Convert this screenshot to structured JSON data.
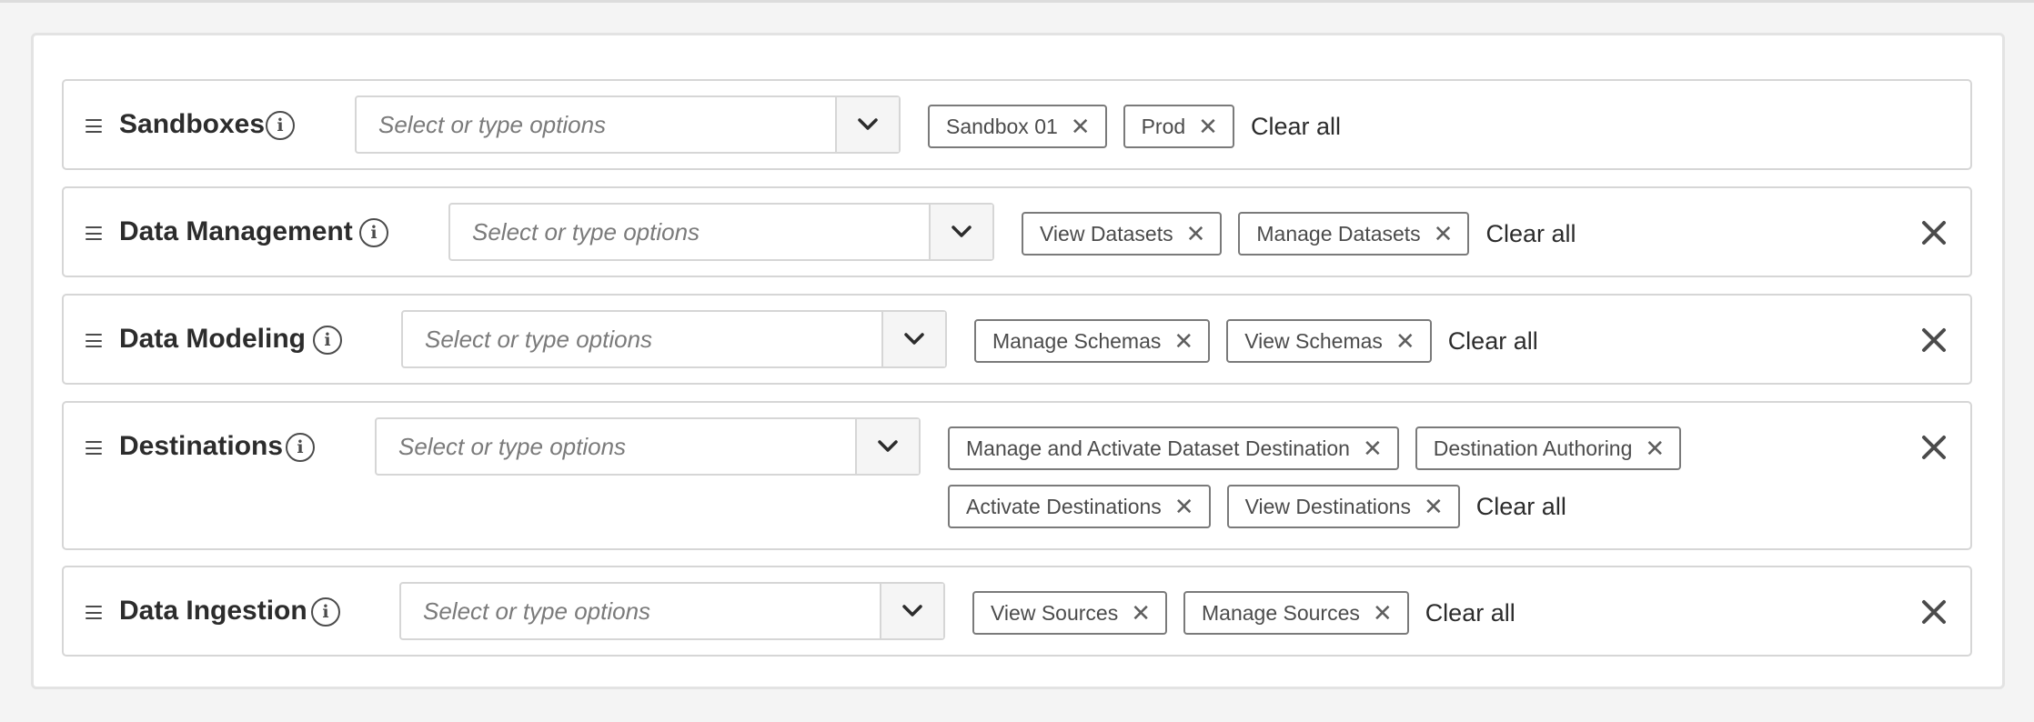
{
  "placeholder": "Select or type options",
  "clear_all_label": "Clear all",
  "icons": {
    "drag_handle": "drag-handle-icon",
    "info": "info-icon",
    "dropdown": "chevron-down-icon",
    "remove_tag": "close-icon",
    "remove_row": "close-icon",
    "info_glyph": "i",
    "tag_remove_glyph": "✕"
  },
  "colors": {
    "page_background": "#f4f4f4",
    "panel_background": "#ffffff",
    "border": "#d6d6d6",
    "tag_border": "#7a7a7a",
    "text": "#2c2c2c"
  },
  "rows": [
    {
      "title": "Sandboxes",
      "removable": false,
      "tags": [
        {
          "label": "Sandbox 01"
        },
        {
          "label": "Prod"
        }
      ]
    },
    {
      "title": "Data Management",
      "removable": true,
      "tags": [
        {
          "label": "View Datasets"
        },
        {
          "label": "Manage Datasets"
        }
      ]
    },
    {
      "title": "Data Modeling",
      "removable": true,
      "tags": [
        {
          "label": "Manage Schemas"
        },
        {
          "label": "View Schemas"
        }
      ]
    },
    {
      "title": "Destinations",
      "removable": true,
      "tags": [
        {
          "label": "Manage and Activate Dataset Destination"
        },
        {
          "label": "Destination Authoring"
        },
        {
          "label": "Activate Destinations"
        },
        {
          "label": "View Destinations"
        }
      ]
    },
    {
      "title": "Data Ingestion",
      "removable": true,
      "tags": [
        {
          "label": "View Sources"
        },
        {
          "label": "Manage Sources"
        }
      ]
    }
  ]
}
